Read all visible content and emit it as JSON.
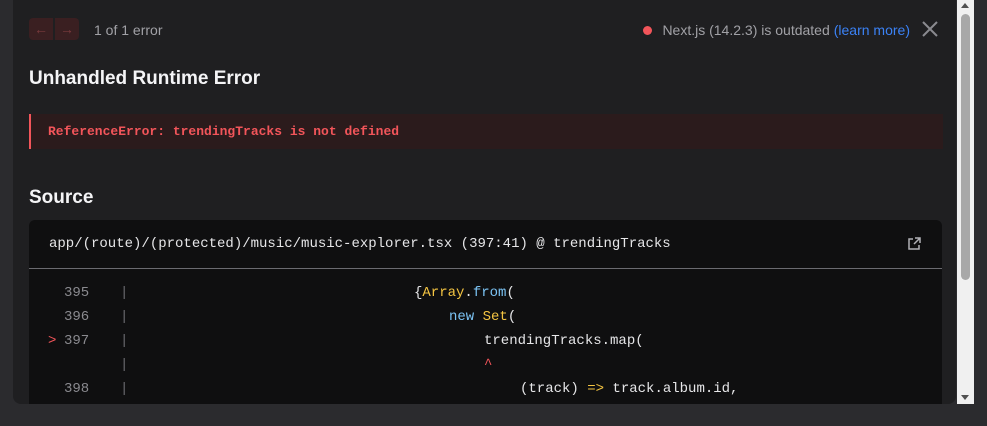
{
  "nav": {
    "prev_icon": "arrow-left",
    "next_icon": "arrow-right"
  },
  "error_count": "1 of 1 error",
  "version": {
    "text": "Next.js (14.2.3) is outdated",
    "link": "(learn more)",
    "status_color": "#f2555a"
  },
  "title": "Unhandled Runtime Error",
  "error": {
    "message": "ReferenceError: trendingTracks is not defined",
    "color": "#f2555a"
  },
  "source": {
    "heading": "Source",
    "file": "app/(route)/(protected)/music/music-explorer.tsx (397:41) @ trendingTracks",
    "lines": [
      {
        "marker": "",
        "num": "395",
        "bar": "|"
      },
      {
        "marker": "",
        "num": "396",
        "bar": "|"
      },
      {
        "marker": ">",
        "num": "397",
        "bar": "|"
      },
      {
        "marker": "",
        "num": "",
        "bar": "|"
      },
      {
        "marker": "",
        "num": "398",
        "bar": "|"
      }
    ],
    "code": {
      "l395_brace": "{",
      "l395_array": "Array",
      "l395_dot": ".",
      "l395_from": "from",
      "l395_paren": "(",
      "l396_new": "new",
      "l396_set": "Set",
      "l396_paren": "(",
      "l397_text": "trendingTracks.map(",
      "caret": "^",
      "l398_a": "(track) ",
      "l398_arrow": "=>",
      "l398_b": " track.album.id,"
    }
  }
}
